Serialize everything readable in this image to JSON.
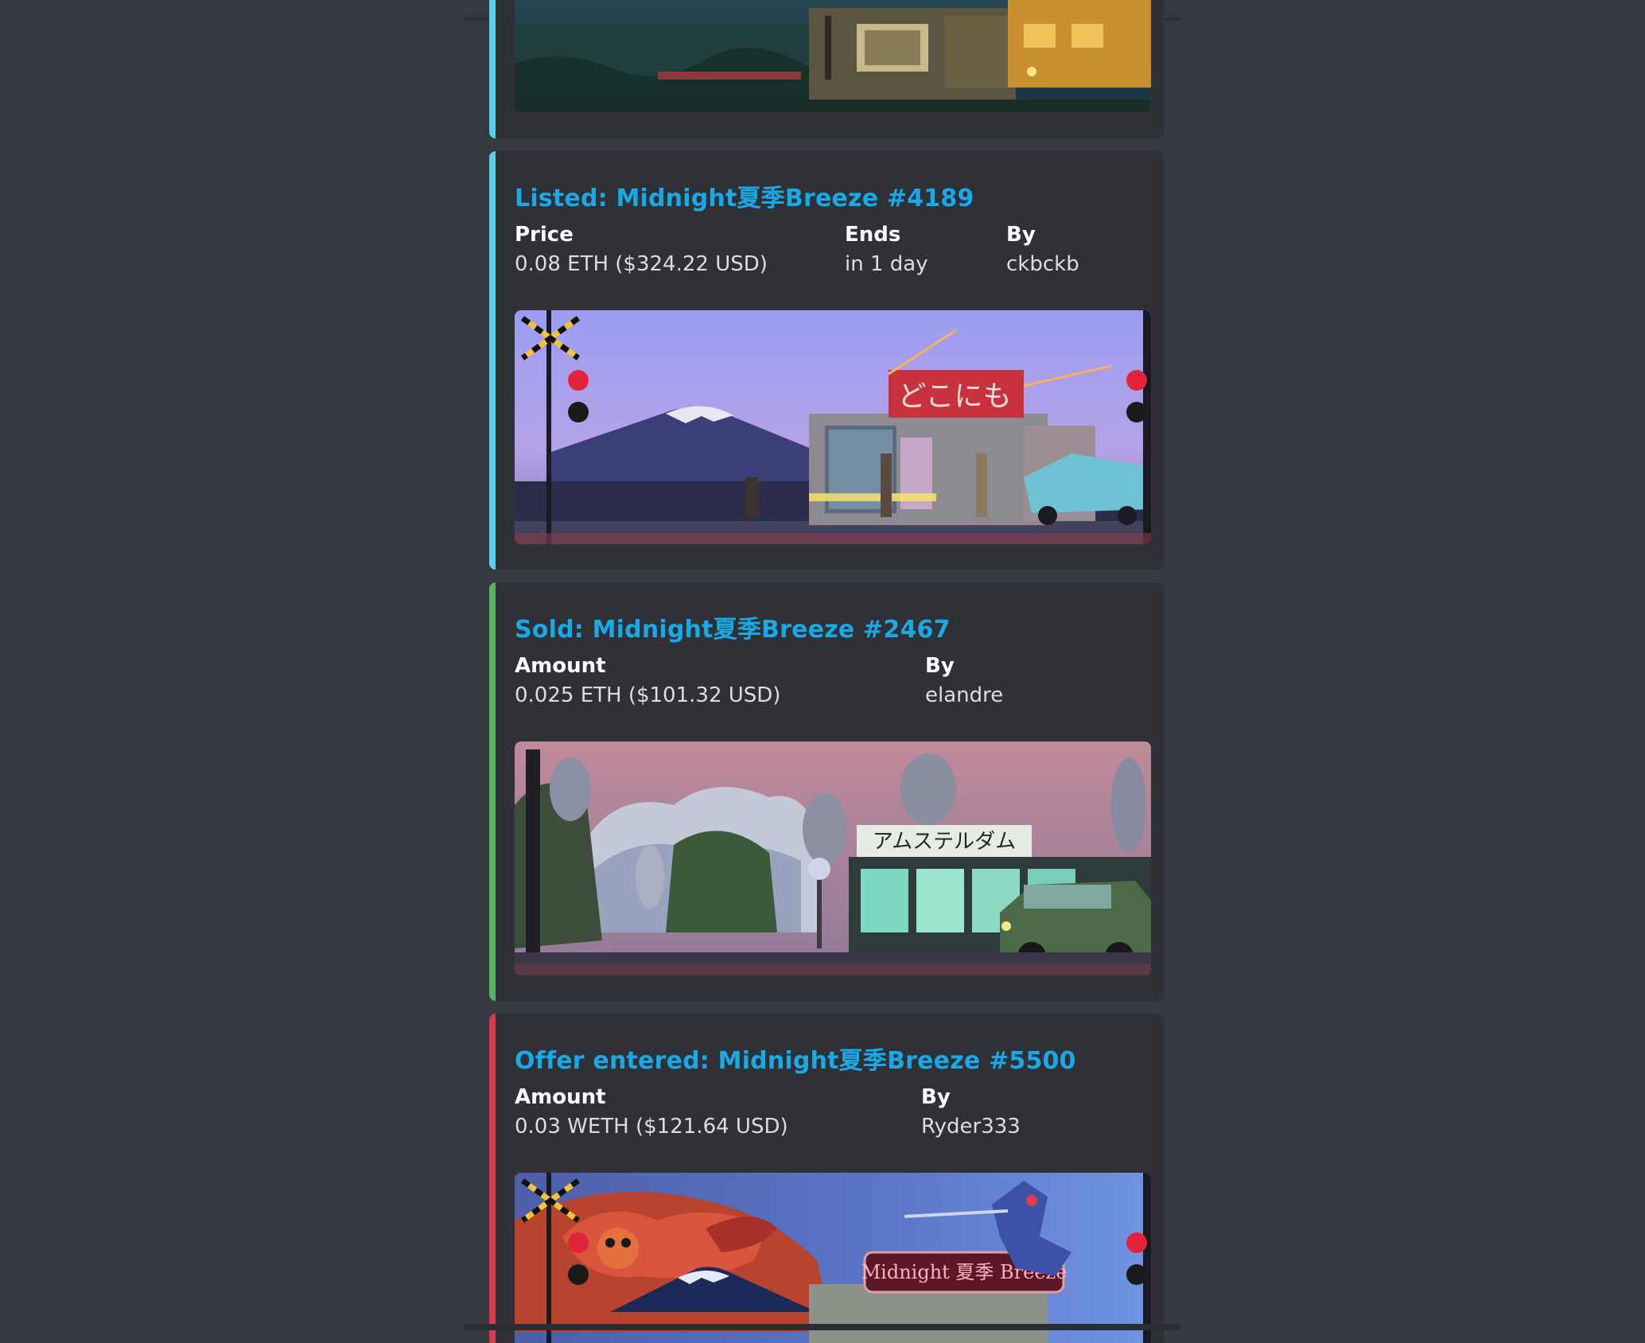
{
  "embeds": [
    {
      "kind": "image-only",
      "accent": "#58d0e9"
    },
    {
      "kind": "listing",
      "accent": "#58d0e9",
      "title": "Listed: Midnight夏季Breeze #4189",
      "fields": [
        {
          "name": "Price",
          "value": "0.08 ETH ($324.22 USD)"
        },
        {
          "name": "Ends",
          "value": "in 1 day"
        },
        {
          "name": "By",
          "value": "ckbckb"
        }
      ],
      "image_sign_text": "どこにも"
    },
    {
      "kind": "sale",
      "accent": "#57b160",
      "title": "Sold: Midnight夏季Breeze #2467",
      "fields": [
        {
          "name": "Amount",
          "value": "0.025 ETH ($101.32 USD)"
        },
        {
          "name": "By",
          "value": "elandre"
        }
      ],
      "image_sign_text": "アムステルダム"
    },
    {
      "kind": "offer",
      "accent": "#d9384f",
      "title": "Offer entered:  Midnight夏季Breeze #5500",
      "fields": [
        {
          "name": "Amount",
          "value": "0.03 WETH ($121.64 USD)"
        },
        {
          "name": "By",
          "value": "Ryder333"
        }
      ],
      "image_sign_text": "Midnight 夏季 Breeze"
    }
  ]
}
